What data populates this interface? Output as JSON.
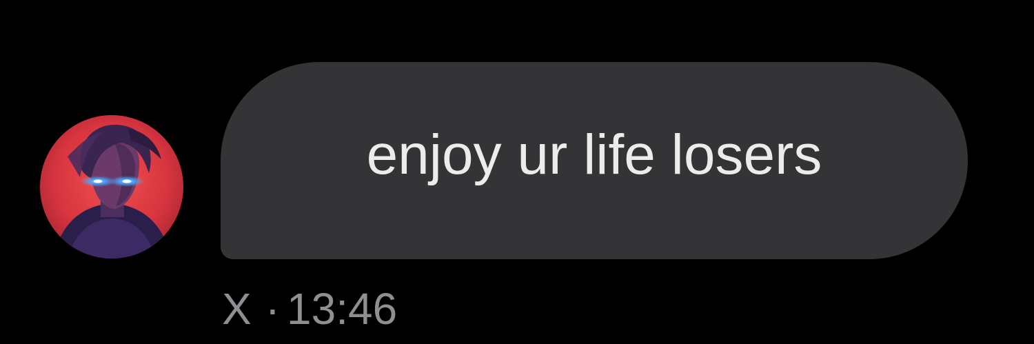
{
  "conversation": {
    "message": {
      "text": "enjoy ur life losers",
      "sender": "X",
      "separator": "·",
      "time": "13:46"
    },
    "avatar": {
      "icon": "profile-avatar-icon"
    }
  },
  "colors": {
    "background": "#000000",
    "bubble": "#343437",
    "message_text": "#ececec",
    "meta_text": "#8e8e93",
    "avatar_red": "#d8353f",
    "avatar_eye_glow": "#4aa8ff"
  }
}
